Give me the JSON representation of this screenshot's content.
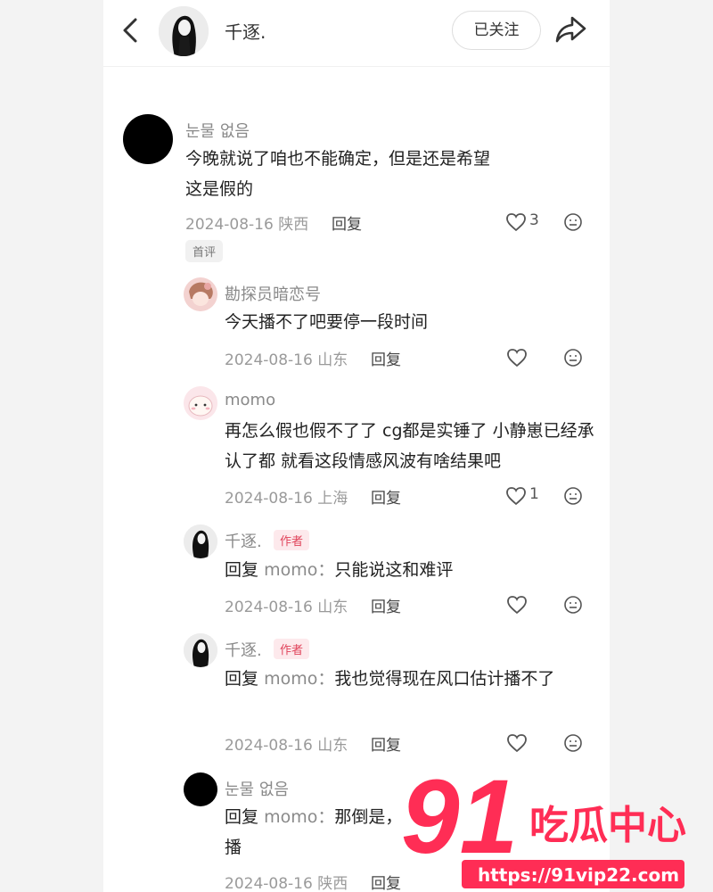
{
  "header": {
    "user_name": "千逐.",
    "follow_label": "已关注"
  },
  "comments": [
    {
      "user": "눈물 없음",
      "text": "今晚就说了咱也不能确定，但是还是希望这是假的",
      "date": "2024-08-16",
      "location": "陕西",
      "reply_label": "回复",
      "likes": "3",
      "badge": "首评"
    },
    {
      "user": "勘探员暗恋号",
      "text": "今天播不了吧要停一段时间",
      "date": "2024-08-16",
      "location": "山东",
      "reply_label": "回复"
    },
    {
      "user": "momo",
      "text": "再怎么假也假不了了 cg都是实锤了 小静崽已经承认了都 就看这段情感风波有啥结果吧",
      "date": "2024-08-16",
      "location": "上海",
      "reply_label": "回复",
      "likes": "1"
    },
    {
      "user": "千逐.",
      "tag": "作者",
      "reply_prefix": "回复",
      "reply_to": "momo：",
      "text": "只能说这和难评",
      "date": "2024-08-16",
      "location": "山东",
      "reply_label": "回复"
    },
    {
      "user": "千逐.",
      "tag": "作者",
      "reply_prefix": "回复",
      "reply_to": "momo：",
      "text": "我也觉得现在风口估计播不了",
      "date": "2024-08-16",
      "location": "山东",
      "reply_label": "回复"
    },
    {
      "user": "눈물 없음",
      "reply_prefix": "回复",
      "reply_to": "momo：",
      "text": "那倒是，",
      "text2": "播",
      "date": "2024-08-16",
      "location": "陕西",
      "reply_label": "回复"
    }
  ],
  "watermark": {
    "number": "91",
    "brand": "吃瓜中心",
    "url": "https://91vip22.com"
  }
}
